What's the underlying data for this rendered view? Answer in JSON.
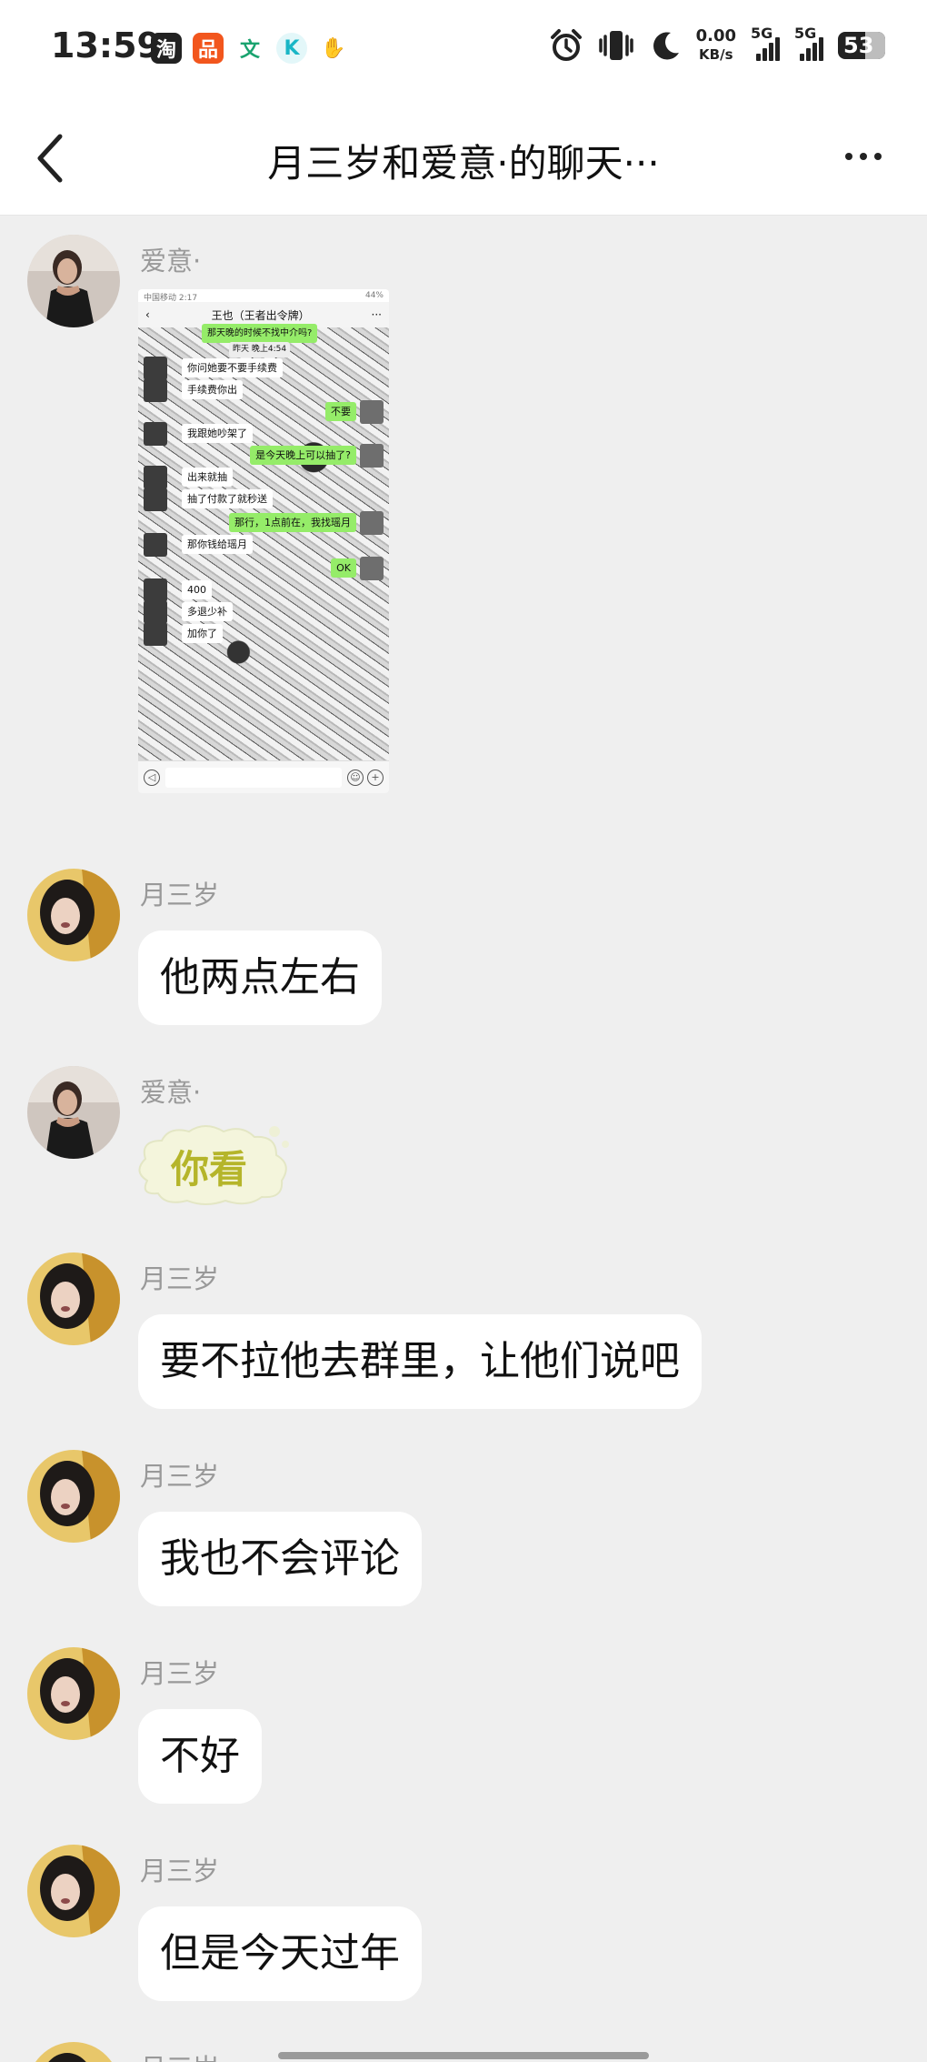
{
  "status_bar": {
    "time": "13:59",
    "app_icons": [
      {
        "name": "taobao-icon",
        "glyph": "淘",
        "color": "#222222"
      },
      {
        "name": "pinduoduo-icon",
        "glyph": "品",
        "color": "#f2561d"
      },
      {
        "name": "wenku-icon",
        "glyph": "文",
        "color": "#1aa36f"
      },
      {
        "name": "kuaishou-icon",
        "glyph": "K",
        "color": "#19b6c6"
      },
      {
        "name": "handshake-icon",
        "glyph": "✋",
        "color": "#333333"
      }
    ],
    "net_speed_value": "0.00",
    "net_speed_unit": "KB/s",
    "sim1_label": "5G",
    "sim2_label": "5G",
    "battery_level": "53"
  },
  "header": {
    "title": "月三岁和爱意·的聊天···"
  },
  "messages": [
    {
      "sender": "爱意·",
      "type": "image",
      "screenshot": {
        "status_left": "中国移动 2:17",
        "status_right": "44%",
        "chat_title": "王也（王者出令牌）",
        "top_text": "那天晚的时候不找中介吗?",
        "time_label": "昨天 晚上4:54",
        "lines": [
          {
            "side": "l",
            "text": "你问她要不要手续费"
          },
          {
            "side": "l",
            "text": "手续费你出"
          },
          {
            "side": "r",
            "text": "不要"
          },
          {
            "side": "l",
            "text": "我跟她吵架了"
          },
          {
            "side": "r",
            "text": "是今天晚上可以抽了?"
          },
          {
            "side": "l",
            "text": "出来就抽"
          },
          {
            "side": "l",
            "text": "抽了付款了就秒送"
          },
          {
            "side": "r",
            "text": "那行，1点前在，我找瑶月"
          },
          {
            "side": "l",
            "text": "那你钱给瑶月"
          },
          {
            "side": "r",
            "text": "OK"
          },
          {
            "side": "l",
            "text": "400"
          },
          {
            "side": "l",
            "text": "多退少补"
          },
          {
            "side": "l",
            "text": "加你了"
          }
        ]
      }
    },
    {
      "sender": "月三岁",
      "type": "text",
      "text": "他两点左右"
    },
    {
      "sender": "爱意·",
      "type": "sticker",
      "text": "你看"
    },
    {
      "sender": "月三岁",
      "type": "text",
      "text": "要不拉他去群里，让他们说吧"
    },
    {
      "sender": "月三岁",
      "type": "text",
      "text": "我也不会评论"
    },
    {
      "sender": "月三岁",
      "type": "text",
      "text": "不好"
    },
    {
      "sender": "月三岁",
      "type": "text",
      "text": "但是今天过年"
    },
    {
      "sender": "月三岁",
      "type": "partial"
    }
  ]
}
